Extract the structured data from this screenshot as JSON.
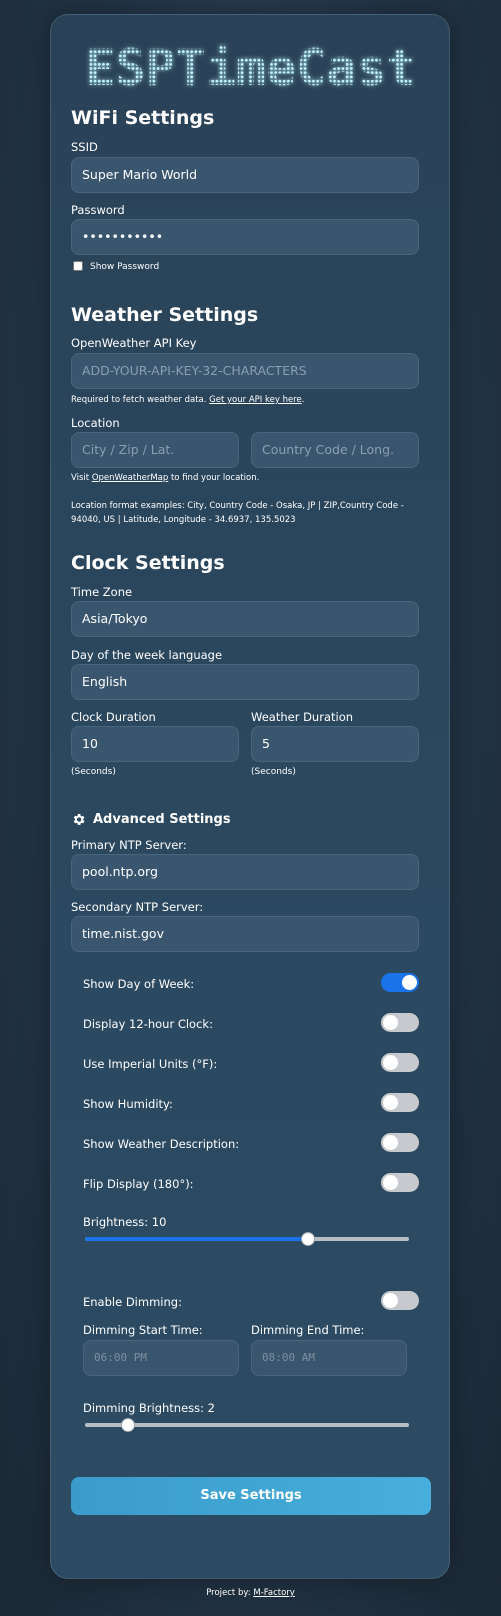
{
  "app": {
    "title": "ESPTimeCast"
  },
  "wifi": {
    "heading": "WiFi Settings",
    "ssid_label": "SSID",
    "ssid_value": "Super Mario World",
    "password_label": "Password",
    "password_value": "•••••••••••",
    "show_password_label": "Show Password"
  },
  "weather": {
    "heading": "Weather Settings",
    "api_key_label": "OpenWeather API Key",
    "api_key_placeholder": "ADD-YOUR-API-KEY-32-CHARACTERS",
    "api_help_text": "Required to fetch weather data.",
    "api_help_link": "Get your API key here",
    "api_help_end": ".",
    "location_label": "Location",
    "city_placeholder": "City / Zip / Lat.",
    "country_placeholder": "Country Code / Long.",
    "visit_text": "Visit",
    "visit_link": "OpenWeatherMap",
    "visit_end": "to find your location.",
    "format_examples": "Location format examples: City, Country Code - Osaka, JP | ZIP,Country Code - 94040, US | Latitude, Longitude - 34.6937, 135.5023"
  },
  "clock": {
    "heading": "Clock Settings",
    "timezone_label": "Time Zone",
    "timezone_value": "Asia/Tokyo",
    "language_label": "Day of the week language",
    "language_value": "English",
    "clock_duration_label": "Clock Duration",
    "clock_duration_value": "10",
    "weather_duration_label": "Weather Duration",
    "weather_duration_value": "5",
    "seconds_hint": "(Seconds)"
  },
  "advanced": {
    "heading": "Advanced Settings",
    "primary_ntp_label": "Primary NTP Server:",
    "primary_ntp_value": "pool.ntp.org",
    "secondary_ntp_label": "Secondary NTP Server:",
    "secondary_ntp_value": "time.nist.gov",
    "toggles": [
      {
        "label": "Show Day of Week:",
        "on": true
      },
      {
        "label": "Display 12-hour Clock:",
        "on": false
      },
      {
        "label": "Use Imperial Units (°F):",
        "on": false
      },
      {
        "label": "Show Humidity:",
        "on": false
      },
      {
        "label": "Show Weather Description:",
        "on": false
      },
      {
        "label": "Flip Display (180°):",
        "on": false
      }
    ],
    "brightness_label": "Brightness: 10",
    "brightness_value": 10,
    "brightness_min": -1,
    "brightness_max": 15,
    "enable_dimming_label": "Enable Dimming:",
    "enable_dimming_on": false,
    "dim_start_label": "Dimming Start Time:",
    "dim_start_value": "06:00 PM",
    "dim_end_label": "Dimming End Time:",
    "dim_end_value": "08:00 AM",
    "dim_brightness_label": "Dimming Brightness: 2",
    "dim_brightness_value": 2,
    "dim_brightness_min": 0,
    "dim_brightness_max": 15
  },
  "save_label": "Save Settings",
  "footer": {
    "text": "Project by:",
    "link": "M-Factory"
  },
  "colors": {
    "accent": "#1a73e8",
    "save_button": "#44a8d6",
    "background": "#24384b"
  }
}
